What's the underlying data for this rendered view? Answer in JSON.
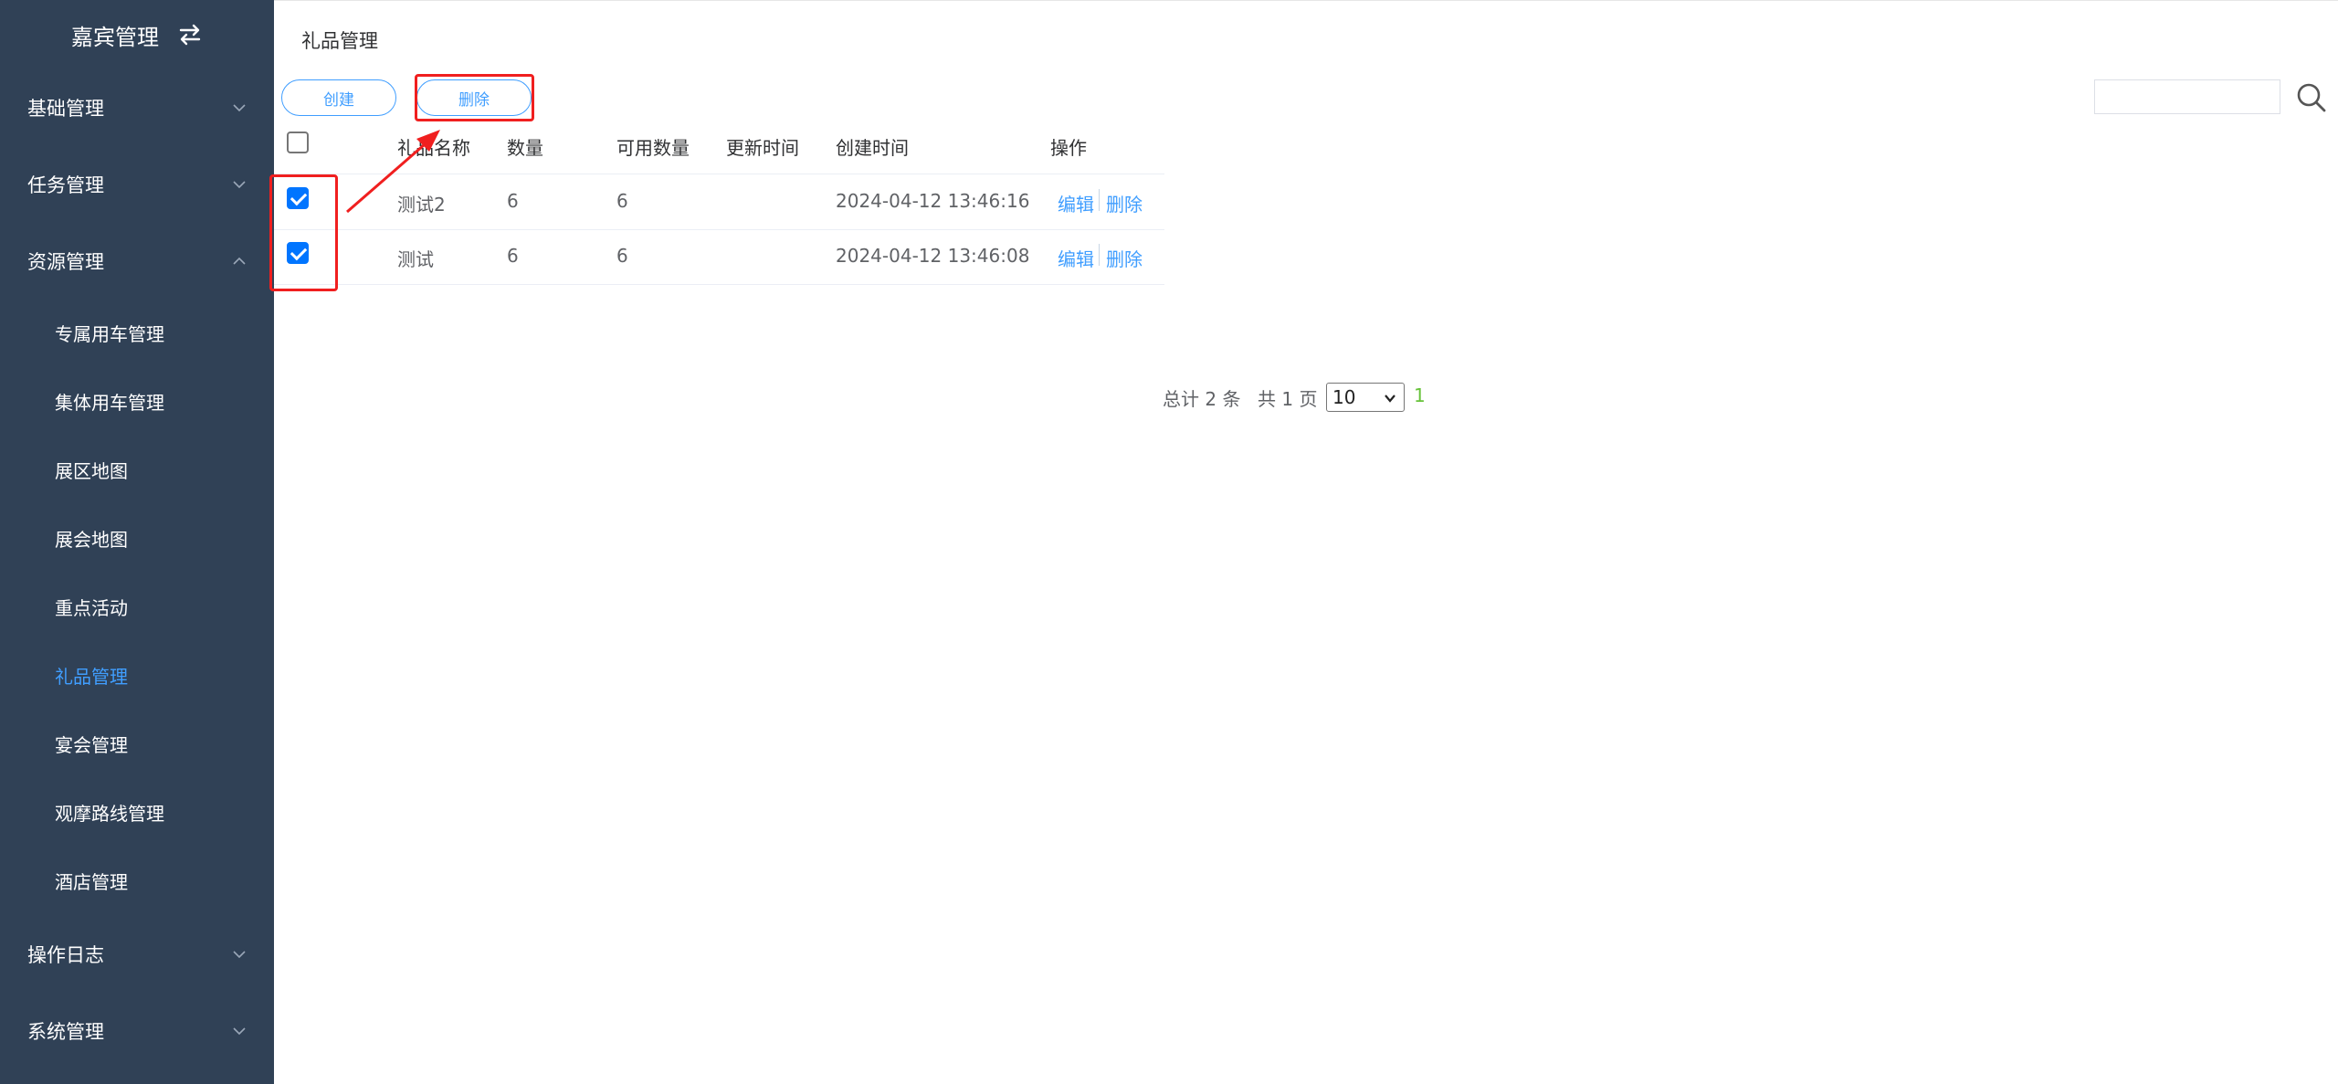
{
  "sidebar": {
    "title": "嘉宾管理",
    "groups": [
      {
        "label": "基础管理"
      },
      {
        "label": "任务管理"
      },
      {
        "label": "资源管理"
      },
      {
        "label": "操作日志"
      },
      {
        "label": "系统管理"
      }
    ],
    "resource_items": [
      {
        "label": "专属用车管理"
      },
      {
        "label": "集体用车管理"
      },
      {
        "label": "展区地图"
      },
      {
        "label": "展会地图"
      },
      {
        "label": "重点活动"
      },
      {
        "label": "礼品管理"
      },
      {
        "label": "宴会管理"
      },
      {
        "label": "观摩路线管理"
      },
      {
        "label": "酒店管理"
      }
    ],
    "active_item": "礼品管理",
    "text_color": "#ffffff",
    "active_color": "#409eff",
    "bg_color": "#304156"
  },
  "main": {
    "page_title": "礼品管理",
    "toolbar": {
      "create_label": "创建",
      "delete_label": "删除"
    },
    "search": {
      "value": "",
      "placeholder": ""
    },
    "table": {
      "columns": [
        "礼品名称",
        "数量",
        "可用数量",
        "更新时间",
        "创建时间",
        "操作"
      ],
      "rows": [
        {
          "name": "测试2",
          "quantity": "6",
          "available": "6",
          "updated": "",
          "created": "2024-04-12 13:46:16",
          "checked": true
        },
        {
          "name": "测试",
          "quantity": "6",
          "available": "6",
          "updated": "",
          "created": "2024-04-12 13:46:08",
          "checked": true
        }
      ],
      "action_edit": "编辑",
      "action_delete": "删除"
    },
    "pagination": {
      "total_text": "总计 2 条",
      "pages_text": "共 1 页",
      "page_size": "10",
      "current_page": "1"
    }
  },
  "colors": {
    "accent": "#409eff",
    "annotation": "#f01f1f",
    "current_page": "#67c23a"
  }
}
